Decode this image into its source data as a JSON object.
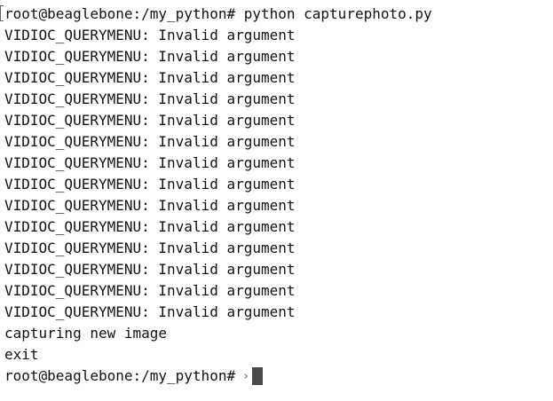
{
  "terminal": {
    "command_line": "root@beaglebone:/my_python# python capturephoto.py",
    "output_lines": [
      "VIDIOC_QUERYMENU: Invalid argument",
      "VIDIOC_QUERYMENU: Invalid argument",
      "VIDIOC_QUERYMENU: Invalid argument",
      "VIDIOC_QUERYMENU: Invalid argument",
      "VIDIOC_QUERYMENU: Invalid argument",
      "VIDIOC_QUERYMENU: Invalid argument",
      "VIDIOC_QUERYMENU: Invalid argument",
      "VIDIOC_QUERYMENU: Invalid argument",
      "VIDIOC_QUERYMENU: Invalid argument",
      "VIDIOC_QUERYMENU: Invalid argument",
      "VIDIOC_QUERYMENU: Invalid argument",
      "VIDIOC_QUERYMENU: Invalid argument",
      "VIDIOC_QUERYMENU: Invalid argument",
      "VIDIOC_QUERYMENU: Invalid argument",
      "capturing new image",
      "exit"
    ],
    "current_prompt": "root@beaglebone:/my_python#",
    "prompt_marker": "›",
    "colors": {
      "background": "#ffffff",
      "text": "#111111",
      "cursor": "#4a4a4a",
      "marker": "#666666"
    }
  }
}
